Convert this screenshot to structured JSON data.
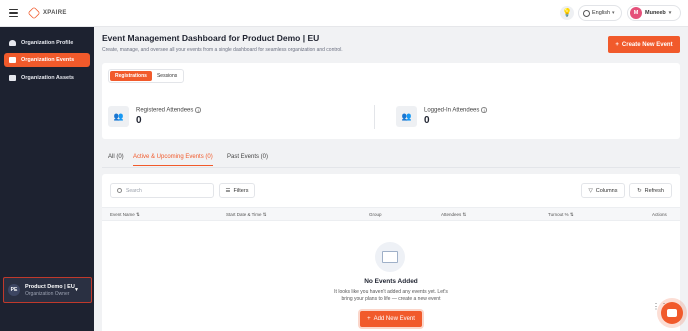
{
  "topbar": {
    "logo_text": "XPAIRE",
    "language": "English",
    "user_initial": "M",
    "user_name": "Muneeb"
  },
  "sidebar": {
    "items": [
      {
        "label": "Organization Profile",
        "active": false
      },
      {
        "label": "Organization Events",
        "active": true
      },
      {
        "label": "Organization Assets",
        "active": false
      }
    ],
    "workspace": {
      "initials": "PE",
      "name": "Product Demo | EU",
      "role": "Organization Owner"
    }
  },
  "header": {
    "title": "Event Management Dashboard for Product Demo | EU",
    "subtitle": "Create, manage, and oversee all your events from a single dashboard for seamless organization and control.",
    "create_button": "Create New Event"
  },
  "summary": {
    "segments": [
      "Registrations",
      "Sessions"
    ],
    "stats": [
      {
        "label": "Registered Attendees",
        "value": "0"
      },
      {
        "label": "Logged-In Attendees",
        "value": "0"
      }
    ]
  },
  "tabs": [
    {
      "label": "All (0)",
      "active": false
    },
    {
      "label": "Active & Upcoming Events (0)",
      "active": true
    },
    {
      "label": "Past Events (0)",
      "active": false
    }
  ],
  "table": {
    "search_placeholder": "Search",
    "filters_label": "Filters",
    "columns_label": "Columns",
    "refresh_label": "Refresh",
    "headers": [
      "Event Name ⇅",
      "Start Date & Time ⇅",
      "Group",
      "Attendees ⇅",
      "Turnout % ⇅",
      "Actions"
    ]
  },
  "empty_state": {
    "title": "No Events Added",
    "description": "It looks like you haven't added any events yet. Let's bring your plans to life — create a new event",
    "button": "Add New Event"
  },
  "colors": {
    "accent": "#f15a2b",
    "sidebar_bg": "#1d2230"
  }
}
